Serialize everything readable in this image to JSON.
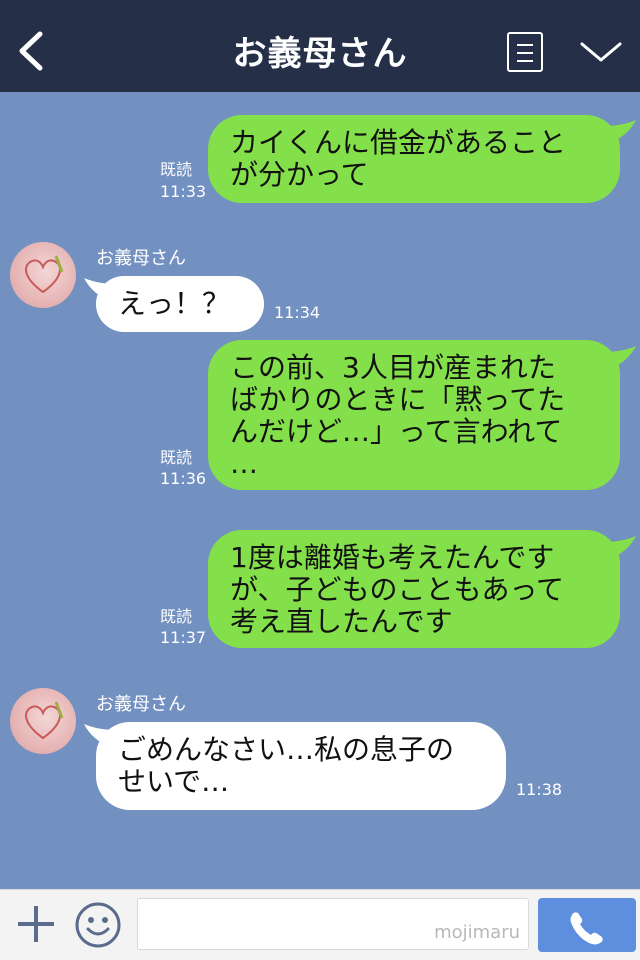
{
  "header": {
    "title": "お義母さん"
  },
  "messages": [
    {
      "type": "out",
      "text": "カイくんに借金があること\nが分かって",
      "read": "既読",
      "time": "11:33"
    },
    {
      "type": "in",
      "sender": "お義母さん",
      "text": "えっ！？",
      "time": "11:34"
    },
    {
      "type": "out",
      "text": "この前、3人目が産まれた\nばかりのときに「黙ってた\nんだけど…」って言われて\n…",
      "read": "既読",
      "time": "11:36"
    },
    {
      "type": "out",
      "text": "1度は離婚も考えたんです\nが、子どものこともあって\n考え直したんです",
      "read": "既読",
      "time": "11:37"
    },
    {
      "type": "in",
      "sender": "お義母さん",
      "text": "ごめんなさい…私の息子の\nせいで…",
      "time": "11:38"
    }
  ],
  "footer": {
    "watermark": "mojimaru"
  },
  "colors": {
    "header": "#253048",
    "background": "#7290c0",
    "out_bubble": "#84e04a",
    "in_bubble": "#ffffff",
    "send_button": "#5d8fde"
  },
  "icons": [
    "back-arrow-icon",
    "menu-list-icon",
    "chevron-down-icon",
    "plus-icon",
    "emoji-icon",
    "phone-icon"
  ]
}
